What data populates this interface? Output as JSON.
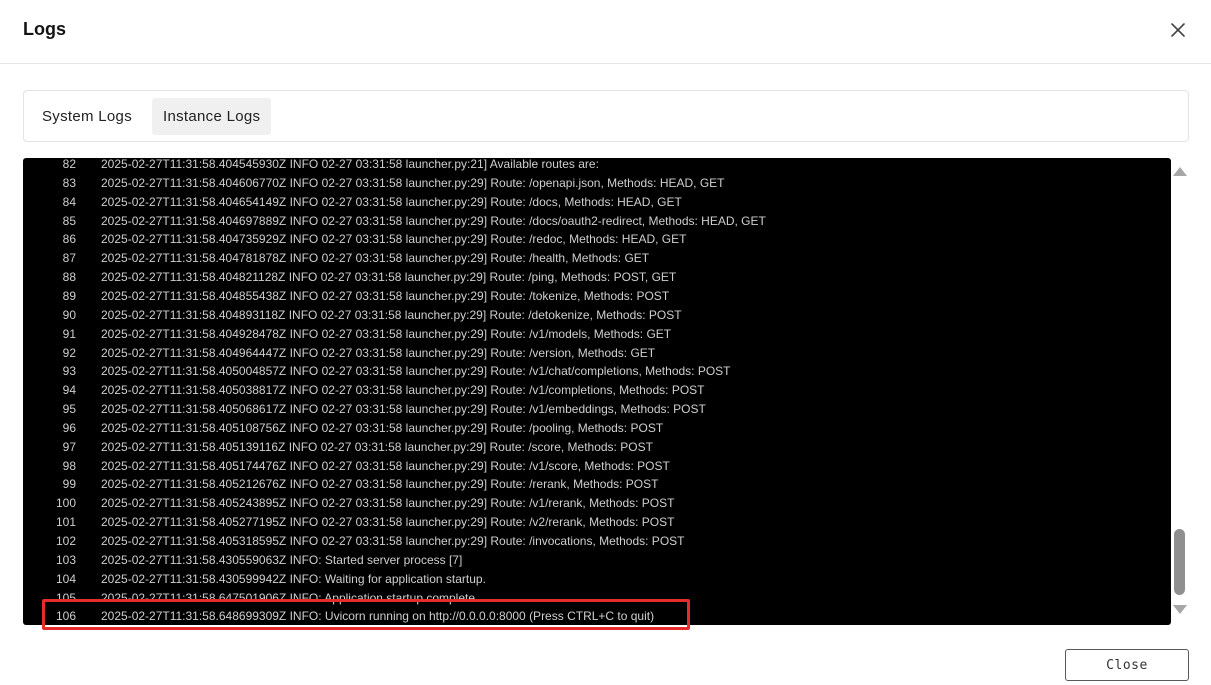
{
  "dialog": {
    "title": "Logs",
    "close_icon": "close-icon",
    "close_button_label": "Close"
  },
  "tabs": [
    {
      "label": "System Logs",
      "active": false
    },
    {
      "label": "Instance Logs",
      "active": true
    }
  ],
  "colors": {
    "console_bg": "#000000",
    "console_text": "#cfcfcf",
    "highlight": "#e52b2b",
    "active_tab_bg": "#f0f0f0"
  },
  "highlighted_line": "106",
  "logs": [
    {
      "n": "82",
      "text": "2025-02-27T11:31:58.404545930Z INFO 02-27 03:31:58 launcher.py:21] Available routes are:"
    },
    {
      "n": "83",
      "text": "2025-02-27T11:31:58.404606770Z INFO 02-27 03:31:58 launcher.py:29] Route: /openapi.json, Methods: HEAD, GET"
    },
    {
      "n": "84",
      "text": "2025-02-27T11:31:58.404654149Z INFO 02-27 03:31:58 launcher.py:29] Route: /docs, Methods: HEAD, GET"
    },
    {
      "n": "85",
      "text": "2025-02-27T11:31:58.404697889Z INFO 02-27 03:31:58 launcher.py:29] Route: /docs/oauth2-redirect, Methods: HEAD, GET"
    },
    {
      "n": "86",
      "text": "2025-02-27T11:31:58.404735929Z INFO 02-27 03:31:58 launcher.py:29] Route: /redoc, Methods: HEAD, GET"
    },
    {
      "n": "87",
      "text": "2025-02-27T11:31:58.404781878Z INFO 02-27 03:31:58 launcher.py:29] Route: /health, Methods: GET"
    },
    {
      "n": "88",
      "text": "2025-02-27T11:31:58.404821128Z INFO 02-27 03:31:58 launcher.py:29] Route: /ping, Methods: POST, GET"
    },
    {
      "n": "89",
      "text": "2025-02-27T11:31:58.404855438Z INFO 02-27 03:31:58 launcher.py:29] Route: /tokenize, Methods: POST"
    },
    {
      "n": "90",
      "text": "2025-02-27T11:31:58.404893118Z INFO 02-27 03:31:58 launcher.py:29] Route: /detokenize, Methods: POST"
    },
    {
      "n": "91",
      "text": "2025-02-27T11:31:58.404928478Z INFO 02-27 03:31:58 launcher.py:29] Route: /v1/models, Methods: GET"
    },
    {
      "n": "92",
      "text": "2025-02-27T11:31:58.404964447Z INFO 02-27 03:31:58 launcher.py:29] Route: /version, Methods: GET"
    },
    {
      "n": "93",
      "text": "2025-02-27T11:31:58.405004857Z INFO 02-27 03:31:58 launcher.py:29] Route: /v1/chat/completions, Methods: POST"
    },
    {
      "n": "94",
      "text": "2025-02-27T11:31:58.405038817Z INFO 02-27 03:31:58 launcher.py:29] Route: /v1/completions, Methods: POST"
    },
    {
      "n": "95",
      "text": "2025-02-27T11:31:58.405068617Z INFO 02-27 03:31:58 launcher.py:29] Route: /v1/embeddings, Methods: POST"
    },
    {
      "n": "96",
      "text": "2025-02-27T11:31:58.405108756Z INFO 02-27 03:31:58 launcher.py:29] Route: /pooling, Methods: POST"
    },
    {
      "n": "97",
      "text": "2025-02-27T11:31:58.405139116Z INFO 02-27 03:31:58 launcher.py:29] Route: /score, Methods: POST"
    },
    {
      "n": "98",
      "text": "2025-02-27T11:31:58.405174476Z INFO 02-27 03:31:58 launcher.py:29] Route: /v1/score, Methods: POST"
    },
    {
      "n": "99",
      "text": "2025-02-27T11:31:58.405212676Z INFO 02-27 03:31:58 launcher.py:29] Route: /rerank, Methods: POST"
    },
    {
      "n": "100",
      "text": "2025-02-27T11:31:58.405243895Z INFO 02-27 03:31:58 launcher.py:29] Route: /v1/rerank, Methods: POST"
    },
    {
      "n": "101",
      "text": "2025-02-27T11:31:58.405277195Z INFO 02-27 03:31:58 launcher.py:29] Route: /v2/rerank, Methods: POST"
    },
    {
      "n": "102",
      "text": "2025-02-27T11:31:58.405318595Z INFO 02-27 03:31:58 launcher.py:29] Route: /invocations, Methods: POST"
    },
    {
      "n": "103",
      "text": "2025-02-27T11:31:58.430559063Z INFO: Started server process [7]"
    },
    {
      "n": "104",
      "text": "2025-02-27T11:31:58.430599942Z INFO: Waiting for application startup."
    },
    {
      "n": "105",
      "text": "2025-02-27T11:31:58.647501906Z INFO: Application startup complete."
    },
    {
      "n": "106",
      "text": "2025-02-27T11:31:58.648699309Z INFO: Uvicorn running on http://0.0.0.0:8000 (Press CTRL+C to quit)"
    }
  ]
}
